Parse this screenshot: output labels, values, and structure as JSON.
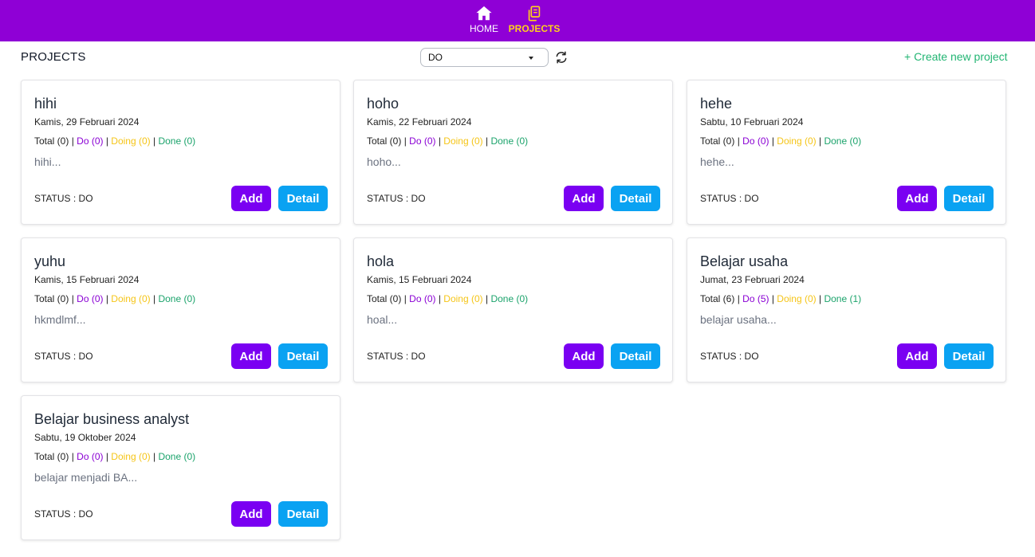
{
  "nav": {
    "home_label": "HOME",
    "projects_label": "PROJECTS",
    "active": "PROJECTS",
    "bar_color": "#8f00d6",
    "active_color": "#ffd21a"
  },
  "header": {
    "title": "PROJECTS",
    "filter_value": "DO",
    "refresh_icon": "refresh-icon",
    "create_label": "+ Create new project"
  },
  "projects": [
    {
      "title": "hihi",
      "date": "Kamis, 29 Februari 2024",
      "total": "Total (0)",
      "do": "Do (0)",
      "doing": "Doing (0)",
      "done": "Done (0)",
      "desc": "hihi...",
      "status": "STATUS : DO",
      "add": "Add",
      "detail": "Detail"
    },
    {
      "title": "hoho",
      "date": "Kamis, 22 Februari 2024",
      "total": "Total (0)",
      "do": "Do (0)",
      "doing": "Doing (0)",
      "done": "Done (0)",
      "desc": "hoho...",
      "status": "STATUS : DO",
      "add": "Add",
      "detail": "Detail"
    },
    {
      "title": "hehe",
      "date": "Sabtu, 10 Februari 2024",
      "total": "Total (0)",
      "do": "Do (0)",
      "doing": "Doing (0)",
      "done": "Done (0)",
      "desc": "hehe...",
      "status": "STATUS : DO",
      "add": "Add",
      "detail": "Detail"
    },
    {
      "title": "yuhu",
      "date": "Kamis, 15 Februari 2024",
      "total": "Total (0)",
      "do": "Do (0)",
      "doing": "Doing (0)",
      "done": "Done (0)",
      "desc": "hkmdlmf...",
      "status": "STATUS : DO",
      "add": "Add",
      "detail": "Detail"
    },
    {
      "title": "hola",
      "date": "Kamis, 15 Februari 2024",
      "total": "Total (0)",
      "do": "Do (0)",
      "doing": "Doing (0)",
      "done": "Done (0)",
      "desc": "hoal...",
      "status": "STATUS : DO",
      "add": "Add",
      "detail": "Detail"
    },
    {
      "title": "Belajar usaha",
      "date": "Jumat, 23 Februari 2024",
      "total": "Total (6)",
      "do": "Do (5)",
      "doing": "Doing (0)",
      "done": "Done (1)",
      "desc": "belajar usaha...",
      "status": "STATUS : DO",
      "add": "Add",
      "detail": "Detail"
    },
    {
      "title": "Belajar business analyst",
      "date": "Sabtu, 19 Oktober 2024",
      "total": "Total (0)",
      "do": "Do (0)",
      "doing": "Doing (0)",
      "done": "Done (0)",
      "desc": "belajar menjadi BA...",
      "status": "STATUS : DO",
      "add": "Add",
      "detail": "Detail"
    }
  ],
  "colors": {
    "add_button": "#7a00f2",
    "detail_button": "#0aa2f2",
    "do": "#8a00d4",
    "doing": "#f5c518",
    "done": "#1ba36b",
    "create_link": "#22b573"
  }
}
